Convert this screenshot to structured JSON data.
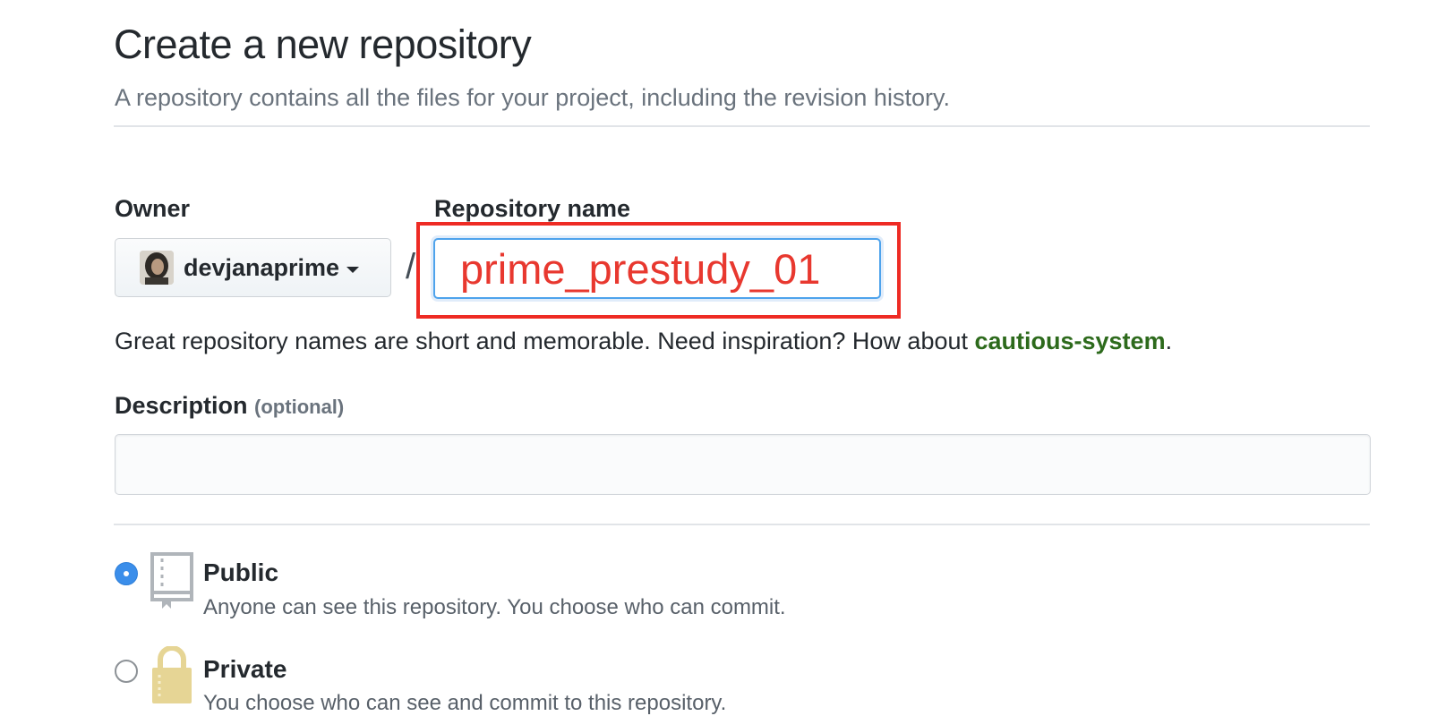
{
  "header": {
    "title": "Create a new repository",
    "subtitle": "A repository contains all the files for your project, including the revision history."
  },
  "owner": {
    "label": "Owner",
    "value": "devjanaprime"
  },
  "separator": "/",
  "repo_name": {
    "label": "Repository name",
    "value": "prime_prestudy_01"
  },
  "hint": {
    "text": "Great repository names are short and memorable. Need inspiration? How about ",
    "suggestion": "cautious-system",
    "suffix": "."
  },
  "description": {
    "label": "Description",
    "optional": "(optional)",
    "value": "",
    "placeholder": ""
  },
  "visibility": {
    "public": {
      "label": "Public",
      "description": "Anyone can see this repository. You choose who can commit.",
      "selected": true
    },
    "private": {
      "label": "Private",
      "description": "You choose who can see and commit to this repository.",
      "selected": false
    }
  },
  "colors": {
    "highlight": "#ee2b24",
    "input_text": "#e8382f",
    "suggestion": "#2d6a1c",
    "radio_selected": "#3b8eea",
    "lock_icon": "#e6d595"
  },
  "icons": [
    "book-icon",
    "lock-icon",
    "caret-down-icon"
  ]
}
